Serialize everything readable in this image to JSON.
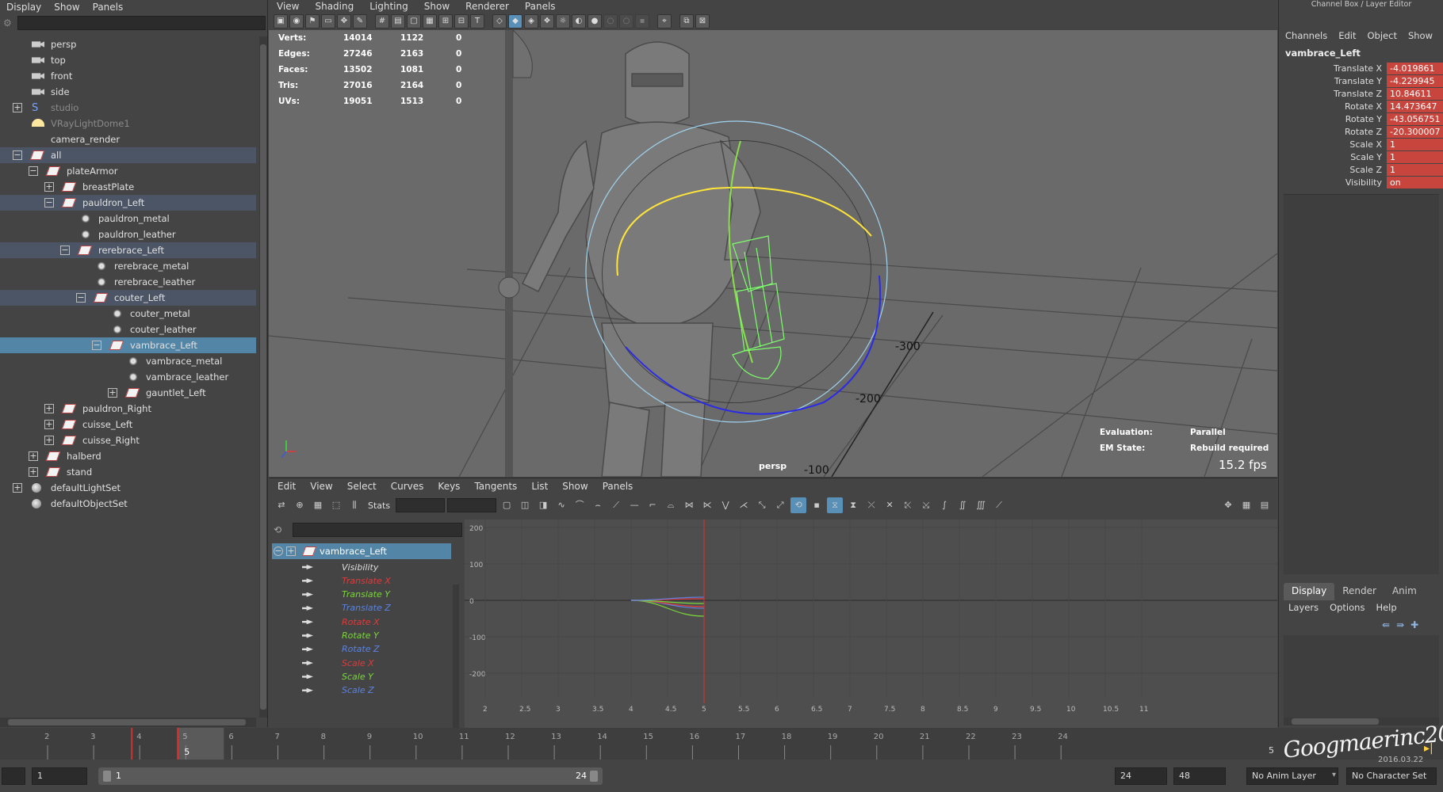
{
  "outliner": {
    "menu": [
      "Display",
      "Show",
      "Panels"
    ],
    "items": [
      {
        "label": "persp",
        "depth": 0,
        "icon": "camera-icon",
        "expander": "",
        "state": ""
      },
      {
        "label": "top",
        "depth": 0,
        "icon": "camera-icon",
        "expander": "",
        "state": ""
      },
      {
        "label": "front",
        "depth": 0,
        "icon": "camera-icon",
        "expander": "",
        "state": ""
      },
      {
        "label": "side",
        "depth": 0,
        "icon": "camera-icon",
        "expander": "",
        "state": ""
      },
      {
        "label": "studio",
        "depth": 0,
        "icon": "studio-icon",
        "expander": "+",
        "state": "dim"
      },
      {
        "label": "VRayLightDome1",
        "depth": 0,
        "icon": "light-dome-icon",
        "expander": "",
        "state": "dim"
      },
      {
        "label": "camera_render",
        "depth": 0,
        "icon": "",
        "expander": "",
        "state": ""
      },
      {
        "label": "all",
        "depth": 0,
        "icon": "transform-icon",
        "expander": "−",
        "state": "hl"
      },
      {
        "label": "plateArmor",
        "depth": 1,
        "icon": "transform-icon",
        "expander": "−",
        "state": ""
      },
      {
        "label": "breastPlate",
        "depth": 2,
        "icon": "transform-icon",
        "expander": "+",
        "state": ""
      },
      {
        "label": "pauldron_Left",
        "depth": 2,
        "icon": "transform-icon",
        "expander": "−",
        "state": "hl"
      },
      {
        "label": "pauldron_metal",
        "depth": 3,
        "icon": "mesh-icon",
        "expander": "",
        "state": ""
      },
      {
        "label": "pauldron_leather",
        "depth": 3,
        "icon": "mesh-icon",
        "expander": "",
        "state": ""
      },
      {
        "label": "rerebrace_Left",
        "depth": 3,
        "icon": "transform-icon",
        "expander": "−",
        "state": "hl"
      },
      {
        "label": "rerebrace_metal",
        "depth": 4,
        "icon": "mesh-icon",
        "expander": "",
        "state": ""
      },
      {
        "label": "rerebrace_leather",
        "depth": 4,
        "icon": "mesh-icon",
        "expander": "",
        "state": ""
      },
      {
        "label": "couter_Left",
        "depth": 4,
        "icon": "transform-icon",
        "expander": "−",
        "state": "hl"
      },
      {
        "label": "couter_metal",
        "depth": 5,
        "icon": "mesh-icon",
        "expander": "",
        "state": ""
      },
      {
        "label": "couter_leather",
        "depth": 5,
        "icon": "mesh-icon",
        "expander": "",
        "state": ""
      },
      {
        "label": "vambrace_Left",
        "depth": 5,
        "icon": "transform-icon",
        "expander": "−",
        "state": "sel"
      },
      {
        "label": "vambrace_metal",
        "depth": 6,
        "icon": "mesh-icon",
        "expander": "",
        "state": ""
      },
      {
        "label": "vambrace_leather",
        "depth": 6,
        "icon": "mesh-icon",
        "expander": "",
        "state": ""
      },
      {
        "label": "gauntlet_Left",
        "depth": 6,
        "icon": "transform-icon",
        "expander": "+",
        "state": ""
      },
      {
        "label": "pauldron_Right",
        "depth": 2,
        "icon": "transform-icon",
        "expander": "+",
        "state": ""
      },
      {
        "label": "cuisse_Left",
        "depth": 2,
        "icon": "transform-icon",
        "expander": "+",
        "state": ""
      },
      {
        "label": "cuisse_Right",
        "depth": 2,
        "icon": "transform-icon",
        "expander": "+",
        "state": ""
      },
      {
        "label": "halberd",
        "depth": 1,
        "icon": "transform-icon",
        "expander": "+",
        "state": ""
      },
      {
        "label": "stand",
        "depth": 1,
        "icon": "transform-icon",
        "expander": "+",
        "state": ""
      },
      {
        "label": "defaultLightSet",
        "depth": 0,
        "icon": "set-icon",
        "expander": "+",
        "state": ""
      },
      {
        "label": "defaultObjectSet",
        "depth": 0,
        "icon": "set-icon",
        "expander": "",
        "state": ""
      }
    ]
  },
  "viewport": {
    "menu": [
      "View",
      "Shading",
      "Lighting",
      "Show",
      "Renderer",
      "Panels"
    ],
    "hud": [
      [
        "Verts:",
        "14014",
        "1122",
        "0"
      ],
      [
        "Edges:",
        "27246",
        "2163",
        "0"
      ],
      [
        "Faces:",
        "13502",
        "1081",
        "0"
      ],
      [
        "Tris:",
        "27016",
        "2164",
        "0"
      ],
      [
        "UVs:",
        "19051",
        "1513",
        "0"
      ]
    ],
    "evaluation_label": "Evaluation:",
    "evaluation_value": "Parallel",
    "em_label": "EM State:",
    "em_value": "Rebuild required",
    "fps": "15.2 fps",
    "camera": "persp",
    "grid_labels": [
      "-300",
      "-200",
      "-100"
    ]
  },
  "channel_box": {
    "title": "Channel Box / Layer Editor",
    "menu": [
      "Channels",
      "Edit",
      "Object",
      "Show"
    ],
    "object": "vambrace_Left",
    "attributes": [
      {
        "name": "Translate X",
        "value": "-4.019861"
      },
      {
        "name": "Translate Y",
        "value": "-4.229945"
      },
      {
        "name": "Translate Z",
        "value": "10.84611"
      },
      {
        "name": "Rotate X",
        "value": "14.473647"
      },
      {
        "name": "Rotate Y",
        "value": "-43.056751"
      },
      {
        "name": "Rotate Z",
        "value": "-20.300007"
      },
      {
        "name": "Scale X",
        "value": "1"
      },
      {
        "name": "Scale Y",
        "value": "1"
      },
      {
        "name": "Scale Z",
        "value": "1"
      },
      {
        "name": "Visibility",
        "value": "on"
      }
    ],
    "tabs": [
      "Display",
      "Render",
      "Anim"
    ],
    "active_tab": "Display",
    "layer_menu": [
      "Layers",
      "Options",
      "Help"
    ],
    "value_color": "#c8453d"
  },
  "graph_editor": {
    "menu": [
      "Edit",
      "View",
      "Select",
      "Curves",
      "Keys",
      "Tangents",
      "List",
      "Show",
      "Panels"
    ],
    "stats_label": "Stats",
    "object": "vambrace_Left",
    "channels": [
      {
        "name": "Visibility",
        "color": "#dddddd"
      },
      {
        "name": "Translate X",
        "color": "#e03a3a"
      },
      {
        "name": "Translate Y",
        "color": "#7bd63a"
      },
      {
        "name": "Translate Z",
        "color": "#5a82e0"
      },
      {
        "name": "Rotate X",
        "color": "#e03a3a"
      },
      {
        "name": "Rotate Y",
        "color": "#7bd63a"
      },
      {
        "name": "Rotate Z",
        "color": "#5a82e0"
      },
      {
        "name": "Scale X",
        "color": "#e03a3a"
      },
      {
        "name": "Scale Y",
        "color": "#7bd63a"
      },
      {
        "name": "Scale Z",
        "color": "#5a82e0"
      }
    ],
    "y_ticks": [
      "200",
      "100",
      "0",
      "-100",
      "-200"
    ],
    "x_ticks": [
      "2",
      "2.5",
      "3",
      "3.5",
      "4",
      "4.5",
      "5",
      "5.5",
      "6",
      "6.5",
      "7",
      "7.5",
      "8",
      "8.5",
      "9",
      "9.5",
      "10",
      "10.5",
      "11"
    ],
    "current_frame": 5
  },
  "timeline": {
    "ticks": [
      "2",
      "3",
      "4",
      "5",
      "6",
      "7",
      "8",
      "9",
      "10",
      "11",
      "12",
      "13",
      "14",
      "15",
      "16",
      "17",
      "18",
      "19",
      "20",
      "21",
      "22",
      "23",
      "24"
    ],
    "current_frame": "5",
    "current_frame_field": "5",
    "range_start_outer": "1",
    "range_start_inner": "1",
    "range_end_inner": "24",
    "range_end_field": "24",
    "range_end_outer": "48",
    "anim_layer": "No Anim Layer",
    "character_set": "No Character Set",
    "signature": "Googmaerinc2011",
    "signature_date": "2016.03.22"
  }
}
